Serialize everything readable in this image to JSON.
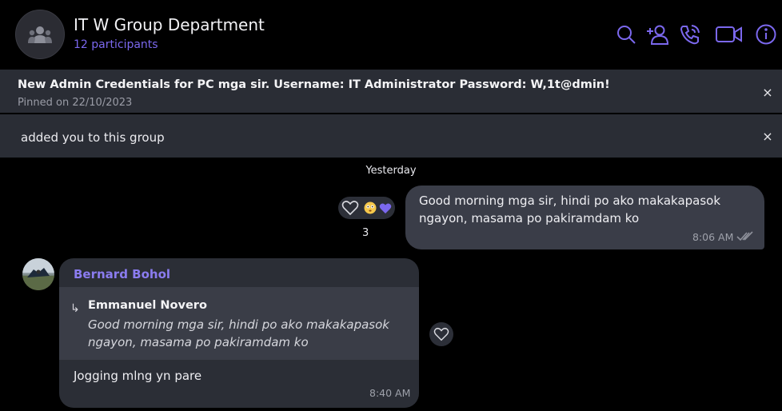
{
  "header": {
    "title": "IT W Group Department",
    "participants": "12 participants",
    "icons": [
      "search-icon",
      "add-participant-icon",
      "phone-call-icon",
      "video-call-icon",
      "info-icon"
    ],
    "accent_color": "#7b68ee"
  },
  "pinned": {
    "text": "New Admin Credentials for PC mga sir. Username: IT Administrator Password: W,1t@dmin!",
    "date": "Pinned on 22/10/2023",
    "close_label": "×"
  },
  "system_notice": {
    "text": "added you to this group",
    "close_label": "×"
  },
  "day_separator": "Yesterday",
  "messages": [
    {
      "direction": "outgoing",
      "text": "Good morning mga sir, hindi po ako makakapasok ngayon, masama po pakiramdam ko",
      "time": "8:06 AM",
      "status": "read",
      "reactions": [
        "heart-outline",
        "flushed-face",
        "purple-heart"
      ],
      "reaction_count": "3"
    },
    {
      "direction": "incoming",
      "sender": "Bernard Bohol",
      "quote": {
        "reply_icon": "↳",
        "name": "Emmanuel Novero",
        "text": "Good morning mga sir, hindi po ako makakapasok ngayon, masama po pakiramdam ko"
      },
      "text": "Jogging mlng yn pare",
      "time": "8:40 AM"
    }
  ]
}
